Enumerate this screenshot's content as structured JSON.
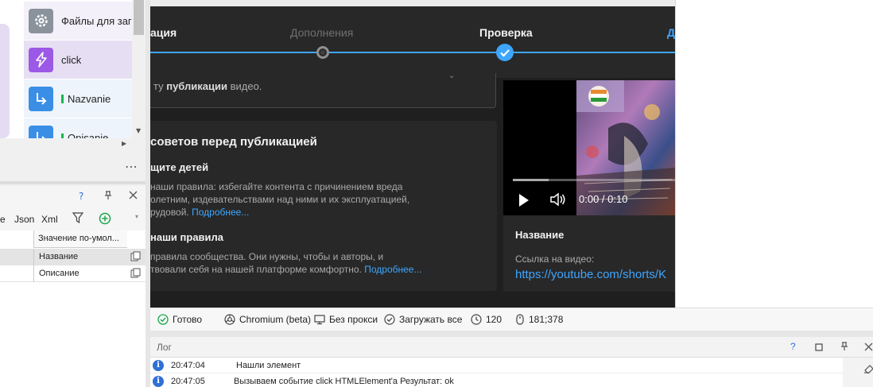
{
  "actions": [
    {
      "label": "Файлы для загр",
      "icon": "gear-icon",
      "color": "#8a929c",
      "bg": "#f3f0f9"
    },
    {
      "label": "click",
      "icon": "lightning-icon",
      "color": "#9b59e6",
      "bg": "#e6dff3"
    },
    {
      "label": "Nazvanie",
      "icon": "arrow-turn-icon",
      "color": "#3a8ee6",
      "bg": "#eef4fb"
    },
    {
      "label": "Opisanie",
      "icon": "arrow-turn-icon",
      "color": "#3a8ee6",
      "bg": "#eef4fb"
    }
  ],
  "props_panel": {
    "help": "?",
    "toolbar": {
      "tab_partial": "e",
      "json": "Json",
      "xml": "Xml"
    },
    "column_header": "Значение по-умол...",
    "rows": [
      {
        "value": "Название",
        "selected": true
      },
      {
        "value": "Описание",
        "selected": false
      }
    ]
  },
  "stepper": {
    "steps": [
      {
        "label": "ация",
        "state": "done"
      },
      {
        "label": "Дополнения",
        "state": "inactive"
      },
      {
        "label": "Проверка",
        "state": "current"
      },
      {
        "label": "Д",
        "state": "next"
      }
    ]
  },
  "description_box": {
    "prefix": "ту ",
    "bold": "публикации",
    "suffix": " видео."
  },
  "tips": {
    "title": "советов перед публикацией",
    "section1": {
      "heading": "щите детей",
      "line1": "наши правила: избегайте контента с причинением вреда",
      "line2": "олетним, издевательствами над ними и их эксплуатацией,",
      "line3": "рудовой.",
      "link": "Подробнее..."
    },
    "section2": {
      "heading": "наши правила",
      "line1": "правила сообщества. Они нужны, чтобы и авторы, и",
      "line2": "твовали себя на нашей платформе комфортно.",
      "link": "Подробнее..."
    }
  },
  "video": {
    "time": "0:00 / 0:10",
    "progress": 0.22,
    "title": "Название",
    "link_label": "Ссылка на видео:",
    "link": "https://youtube.com/shorts/K"
  },
  "statusbar": {
    "ready": "Готово",
    "browser": "Chromium (beta)",
    "proxy": "Без прокси",
    "load": "Загружать все",
    "timeout": "120",
    "coords": "181;378"
  },
  "log": {
    "title": "Лог",
    "help": "?",
    "rows": [
      {
        "time": "20:47:04",
        "message": "Нашли элемент"
      },
      {
        "time": "20:47:05",
        "message": "Вызываем событие click HTMLElement'a  Результат: ok"
      }
    ]
  },
  "colors": {
    "accent": "#3ea6ff",
    "dark_bg": "#1f1f1f",
    "card_bg": "#282828"
  }
}
